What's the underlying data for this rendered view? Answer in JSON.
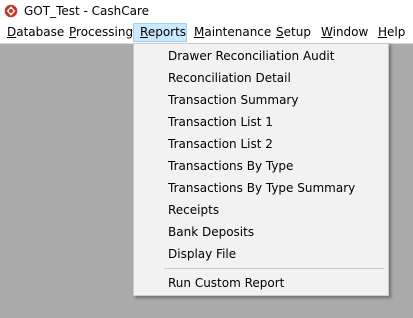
{
  "window": {
    "title": "GOT_Test - CashCare",
    "icon": "cashcare-app-icon",
    "icon_color": "#c0392b"
  },
  "menubar": {
    "items": [
      {
        "id": "database",
        "first": "D",
        "rest": "atabase"
      },
      {
        "id": "processing",
        "first": "P",
        "rest": "rocessing"
      },
      {
        "id": "reports",
        "first": "R",
        "rest": "eports"
      },
      {
        "id": "maintenance",
        "first": "M",
        "rest": "aintenance"
      },
      {
        "id": "setup",
        "first": "S",
        "rest": "etup"
      },
      {
        "id": "window",
        "first": "W",
        "rest": "indow"
      },
      {
        "id": "help",
        "first": "H",
        "rest": "elp"
      }
    ],
    "active_item": "Reports"
  },
  "reports_menu": {
    "items": [
      "Drawer Reconciliation Audit",
      "Reconciliation Detail",
      "Transaction Summary",
      "Transaction List 1",
      "Transaction List 2",
      "Transactions By Type",
      "Transactions By Type Summary",
      "Receipts",
      "Bank Deposits",
      "Display File",
      "Run Custom Report"
    ]
  },
  "colors": {
    "workspace": "#ababab",
    "menu_highlight": "#cce8ff",
    "menu_highlight_border": "#99d1ff",
    "dropdown_bg": "#f2f2f2"
  }
}
